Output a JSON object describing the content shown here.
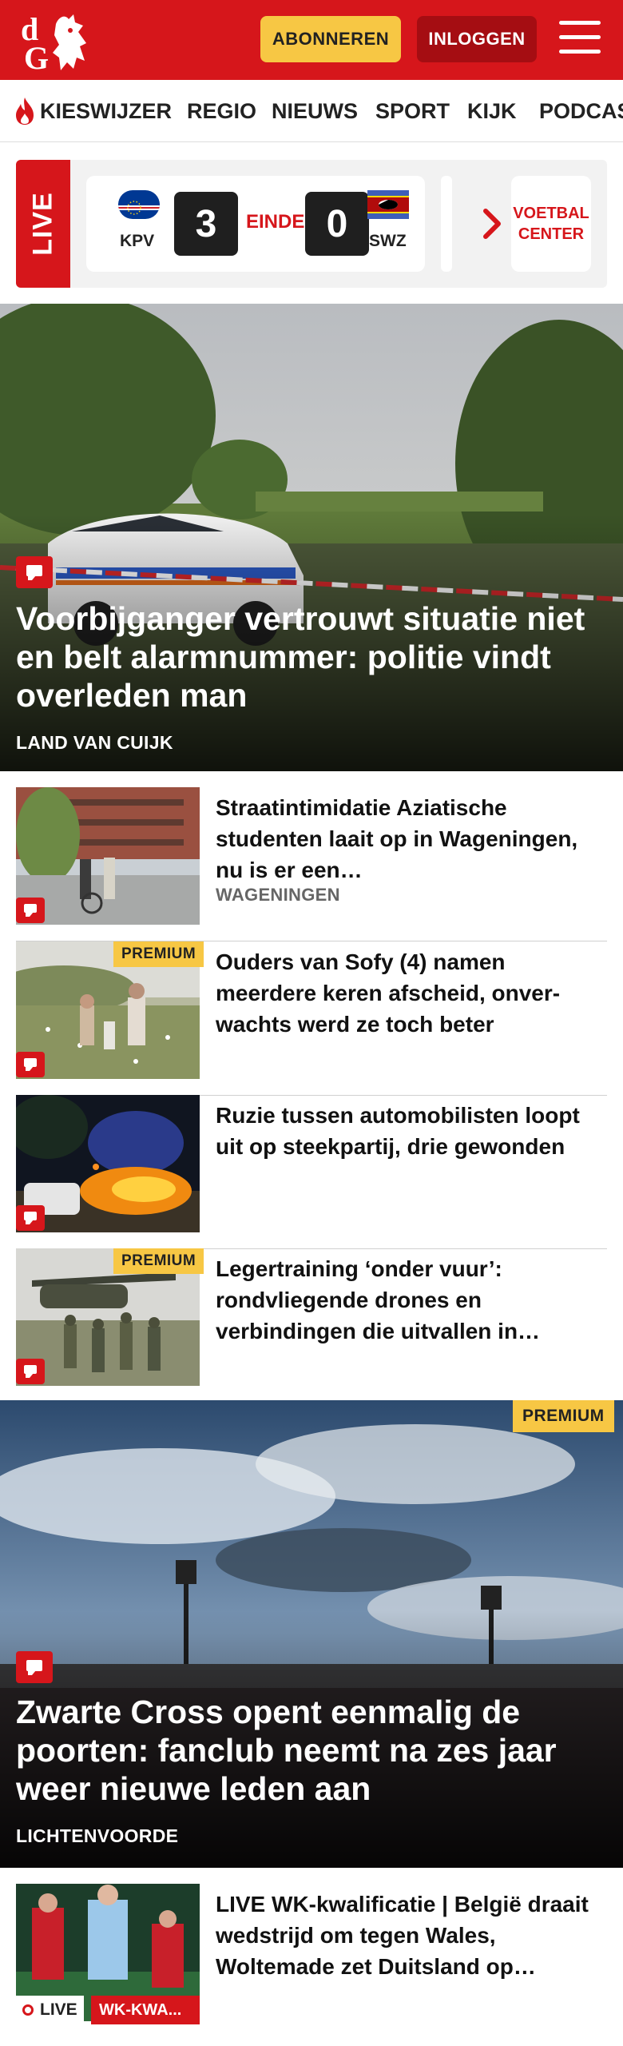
{
  "header": {
    "logo_text": "dG",
    "subscribe_label": "ABONNEREN",
    "login_label": "INLOGGEN",
    "menu_icon": "hamburger-icon"
  },
  "nav": {
    "items": [
      {
        "label": "KIESWIJZER",
        "icon": "flame-icon"
      },
      {
        "label": "REGIO"
      },
      {
        "label": "NIEUWS"
      },
      {
        "label": "SPORT"
      },
      {
        "label": "KIJK"
      },
      {
        "label": "PODCAS"
      }
    ]
  },
  "live_scores": {
    "live_label": "LIVE",
    "match": {
      "home_code": "KPV",
      "home_score": "3",
      "status": "EINDE",
      "away_score": "0",
      "away_code": "SWZ"
    },
    "voetbal_center_line1": "VOETBAL",
    "voetbal_center_line2": "CENTER"
  },
  "hero": {
    "title": "Voorbijganger vertrouwt situatie niet en belt alarmnummer: politie vindt overleden man",
    "location": "LAND VAN CUIJK"
  },
  "articles": [
    {
      "title": "Straatintimidatie Aziatische studenten laait op in Wageningen, nu is er een…",
      "location": "WAGENINGEN",
      "premium": ""
    },
    {
      "title": "Ouders van Sofy (4) namen meerdere keren afscheid, onver-wachts werd ze toch beter",
      "location": "",
      "premium": "PREMIUM"
    },
    {
      "title": "Ruzie tussen automobilisten loopt uit op steekpartij, drie gewonden",
      "location": "",
      "premium": ""
    },
    {
      "title": "Legertraining ‘onder vuur’: rondvliegende drones en verbindingen die uitvallen in…",
      "location": "",
      "premium": "PREMIUM"
    }
  ],
  "hero2": {
    "premium": "PREMIUM",
    "title": "Zwarte Cross opent eenmalig de poorten: fanclub neemt na zes jaar weer nieuwe leden aan",
    "location": "LICHTENVOORDE"
  },
  "article_live": {
    "title": "LIVE WK-kwalificatie | België draait wedstrijd om tegen Wales, Woltemade zet Duitsland op…",
    "live_label": "LIVE",
    "badge": "WK-KWA..."
  },
  "colors": {
    "brand_red": "#d6161b",
    "premium_yellow": "#f7c744"
  }
}
